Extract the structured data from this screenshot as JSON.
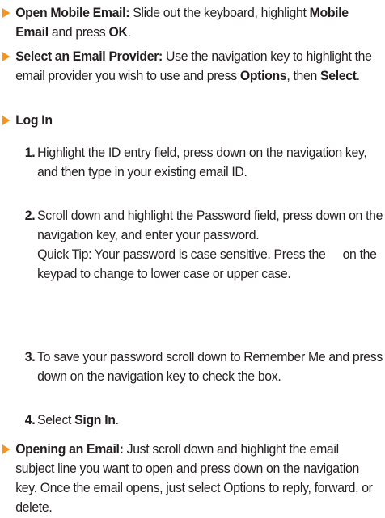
{
  "entries": {
    "open_mobile_email": {
      "title": "Open Mobile Email:",
      "text_1": " Slide out the keyboard, highlight ",
      "bold_1": "Mobile Email",
      "text_2": " and press ",
      "bold_2": "OK",
      "text_3": "."
    },
    "select_provider": {
      "title": "Select an Email Provider:",
      "text_1": " Use the navigation key to highlight the email provider you wish to use and press ",
      "bold_1": "Options",
      "text_2": ", then ",
      "bold_2": "Select",
      "text_3": "."
    },
    "log_in": {
      "title": "Log In"
    },
    "opening_email": {
      "title": "Opening an Email:",
      "text_1": " Just scroll down and highlight the email subject line you want to open and press down on the navigation key. Once the email opens, just select Options to reply, forward, or delete."
    }
  },
  "steps": [
    {
      "num": "1.",
      "text": "Highlight the ID entry field, press down on the navigation key, and then type in your existing email ID."
    },
    {
      "num": "2.",
      "text": "Scroll down and highlight the Password field, press down on the navigation key, and enter your password.",
      "tip_1": "Quick Tip: Your password is case sensitive. Press the",
      "tip_2": "on the keypad to change to lower case or upper case."
    },
    {
      "num": "3.",
      "text": "To save your password scroll down to Remember Me and press down on the navigation key to check the box."
    },
    {
      "num": "4.",
      "text_1": "Select ",
      "bold_1": "Sign In",
      "text_2": "."
    }
  ],
  "colors": {
    "marker": "#f7941d",
    "text": "#231f20",
    "background": "#ffffff"
  }
}
